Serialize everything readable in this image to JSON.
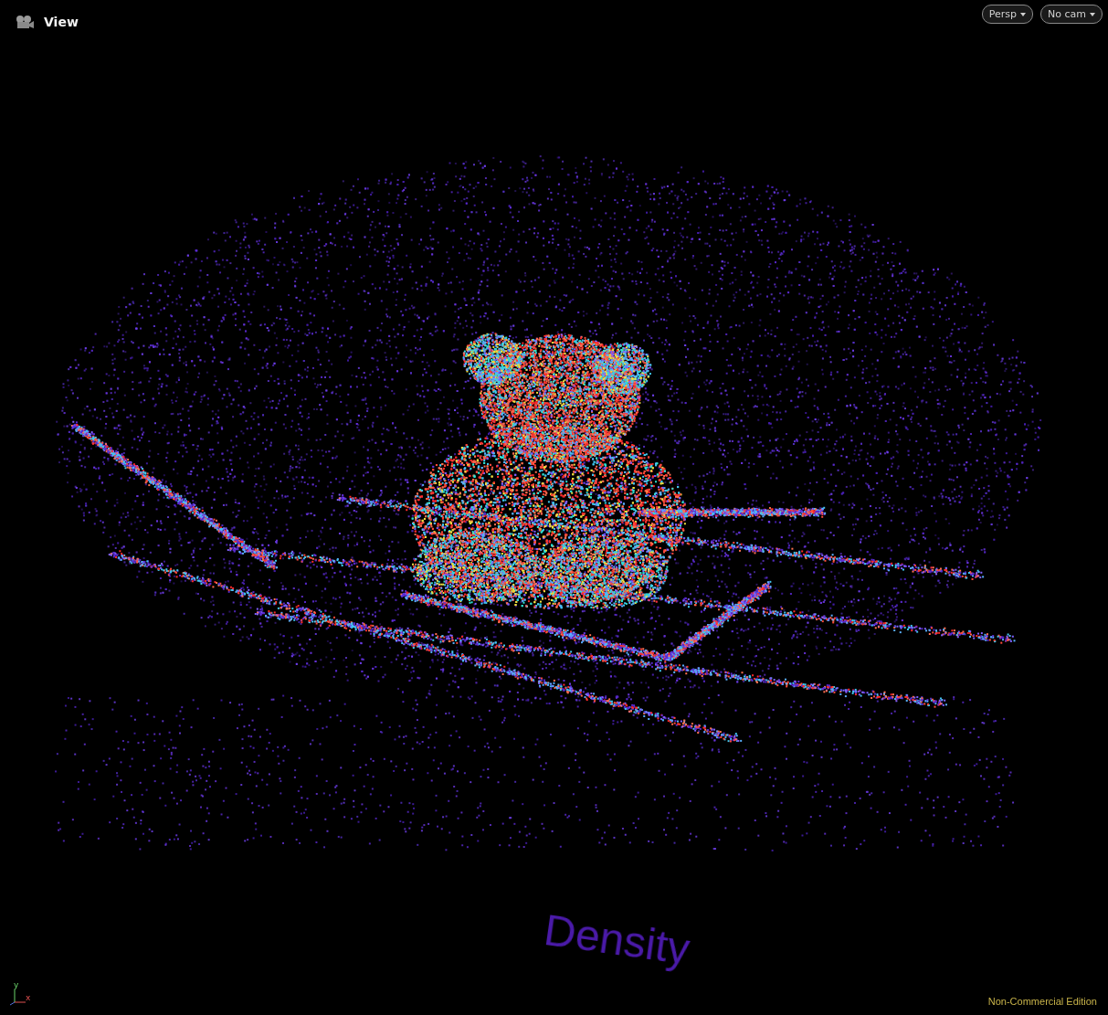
{
  "viewer": {
    "title": "View"
  },
  "view_buttons": [
    {
      "label": "Persp"
    },
    {
      "label": "No cam"
    }
  ],
  "visualizer_label": "Density",
  "axes": [
    {
      "label": "y"
    },
    {
      "label": "x"
    }
  ],
  "license": "Non-Commercial Edition"
}
